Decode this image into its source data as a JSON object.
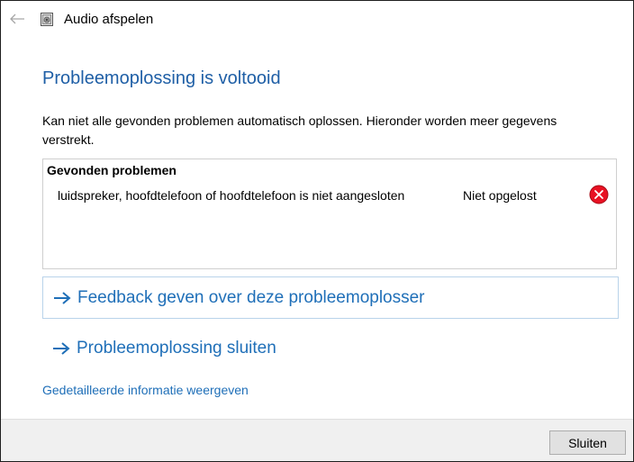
{
  "window": {
    "title": "Audio afspelen",
    "back_icon": "arrow-left-icon",
    "app_icon": "speaker-app-icon"
  },
  "main": {
    "heading": "Probleemoplossing is voltooid",
    "description": "Kan niet alle gevonden problemen automatisch oplossen. Hieronder worden meer gegevens verstrekt.",
    "problems": {
      "header": "Gevonden problemen",
      "items": [
        {
          "description": "luidspreker, hoofdtelefoon of hoofdtelefoon is niet aangesloten",
          "status": "Niet opgelost",
          "status_icon": "error-icon"
        }
      ]
    },
    "links": [
      {
        "label": "Feedback geven over deze probleemoplosser",
        "icon": "arrow-right-icon"
      },
      {
        "label": "Probleemoplossing sluiten",
        "icon": "arrow-right-icon"
      }
    ],
    "details_link": "Gedetailleerde informatie weergeven"
  },
  "footer": {
    "close_label": "Sluiten"
  },
  "colors": {
    "heading": "#1f5fa6",
    "link": "#1f6fb8",
    "error": "#e81123",
    "footer_bg": "#f0f0f0"
  }
}
